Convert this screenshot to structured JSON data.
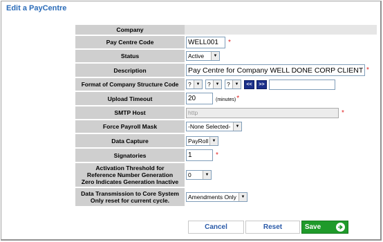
{
  "page": {
    "title": "Edit a PayCentre"
  },
  "form": {
    "company": {
      "label": "Company",
      "value": ""
    },
    "pay_centre_code": {
      "label": "Pay Centre Code",
      "value": "WELL001",
      "required": "*"
    },
    "status": {
      "label": "Status",
      "value": "Active"
    },
    "description": {
      "label": "Description",
      "value": "Pay Centre for Company WELL DONE CORP CLIENT",
      "required": "*"
    },
    "format": {
      "label": "Format of Company Structure Code",
      "selects": [
        "?",
        "?",
        "?"
      ],
      "prev_label": "<<",
      "next_label": ">>",
      "text_value": ""
    },
    "upload_timeout": {
      "label": "Upload Timeout",
      "value": "20",
      "unit": "(minutes)",
      "required": "*"
    },
    "smtp_host": {
      "label": "SMTP Host",
      "placeholder": "http",
      "required": "*"
    },
    "force_payroll_mask": {
      "label": "Force Payroll Mask",
      "value": "-None Selected-"
    },
    "data_capture": {
      "label": "Data Capture",
      "value": "PayRoll"
    },
    "signatories": {
      "label": "Signatories",
      "value": "1",
      "required": "*"
    },
    "activation_threshold": {
      "label_line1": "Activation Threshold for",
      "label_line2": "Reference Number Generation",
      "label_line3": "Zero Indicates Generation Inactive",
      "value": "0"
    },
    "data_transmission": {
      "label_line1": "Data Transmission to Core System",
      "label_line2": "Only reset for current cycle.",
      "value": "Amendments Only"
    }
  },
  "buttons": {
    "cancel": "Cancel",
    "reset": "Reset",
    "save": "Save"
  },
  "colors": {
    "title": "#2a6bb8",
    "label_bg": "#cfcfcf",
    "save_bg": "#1f9a2a",
    "nav_bg": "#1a2f8a",
    "required": "#e02020"
  }
}
